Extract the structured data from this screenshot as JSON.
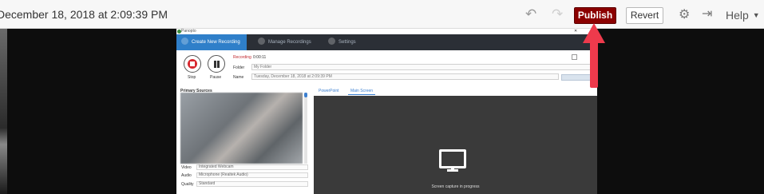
{
  "toolbar": {
    "timestamp": "December 18, 2018 at 2:09:39 PM",
    "undo_icon": "undo-icon",
    "redo_icon": "redo-icon",
    "publish_label": "Publish",
    "revert_label": "Revert",
    "settings_icon": "gear-icon",
    "exit_icon": "exit-icon",
    "help_label": "Help",
    "colors": {
      "publish_bg": "#8b0000",
      "toolbar_bg": "#f7f7f7"
    }
  },
  "annotation": {
    "arrow_color": "#ee3a4c",
    "target": "publish-button"
  },
  "recorder": {
    "title": "Panopto",
    "nav": {
      "create": "Create New Recording",
      "manage": "Manage Recordings",
      "settings": "Settings"
    },
    "controls": {
      "stop": "Stop",
      "pause": "Pause"
    },
    "fields": {
      "recording_label": "Recording",
      "recording_value": "0:00:11",
      "folder_label": "Folder",
      "folder_value": "My Folder",
      "name_label": "Name",
      "name_value": "Tuesday, December 18, 2018 at 2:09:39 PM"
    },
    "primary_sources": {
      "header": "Primary Sources",
      "video_label": "Video",
      "video_value": "Integrated Webcam",
      "audio_label": "Audio",
      "audio_value": "Microphone (Realtek Audio)",
      "quality_label": "Quality",
      "quality_value": "Standard"
    },
    "tabs": {
      "powerpoint": "PowerPoint",
      "main_screen": "Main Screen"
    },
    "capture_text": "Screen capture in progress",
    "colors": {
      "nav_bg": "#2b2f36",
      "nav_active": "#2f7fc9",
      "record_red": "#d7282f"
    }
  }
}
